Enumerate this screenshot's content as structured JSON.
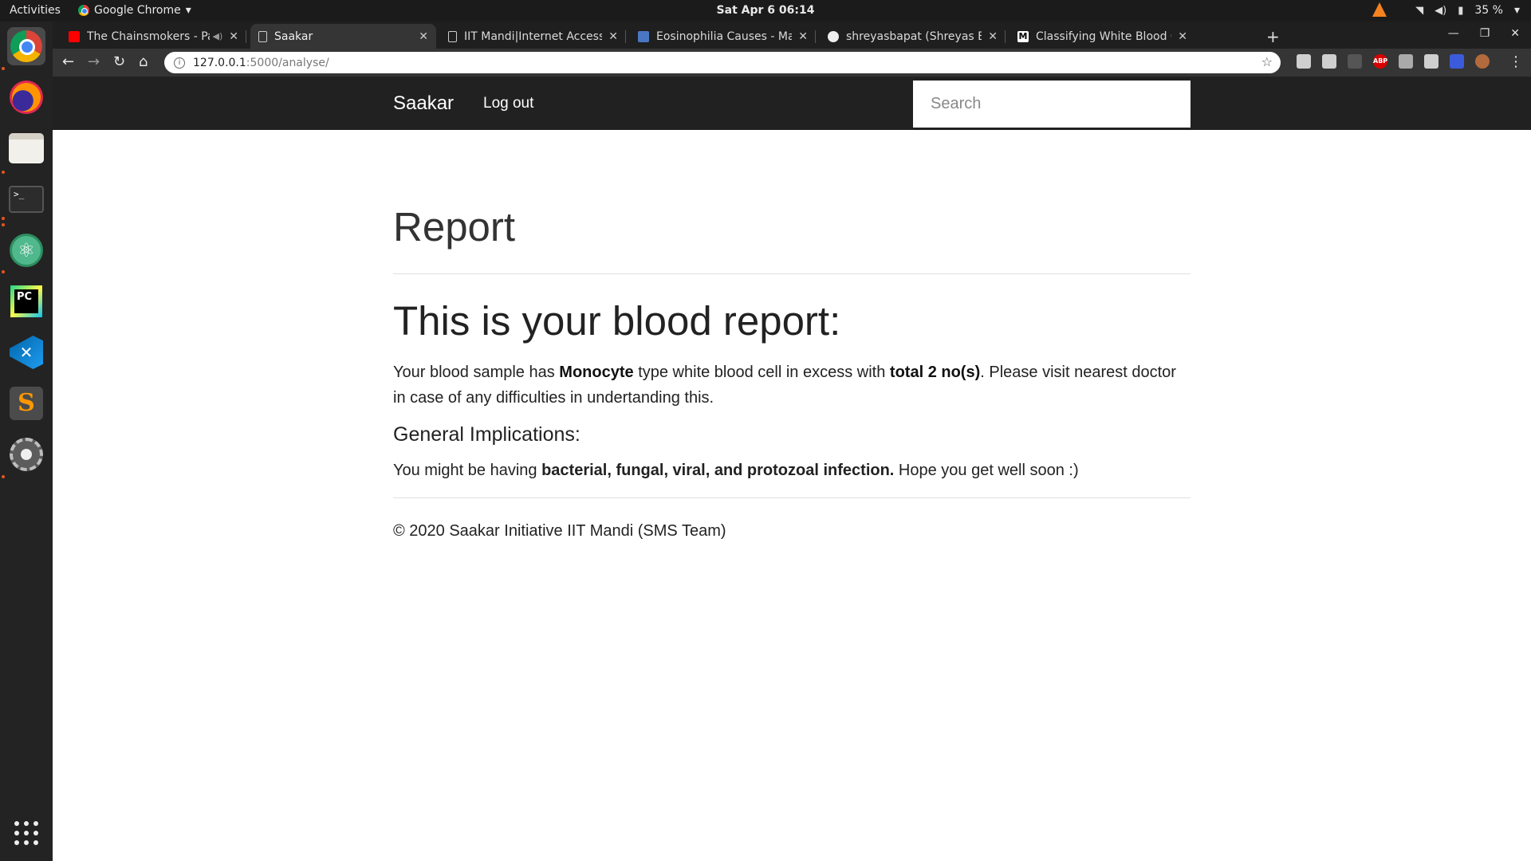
{
  "top_bar": {
    "activities": "Activities",
    "app_name": "Google Chrome",
    "clock": "Sat Apr 6  06:14",
    "battery": "35 %"
  },
  "dock": {
    "apps": [
      "Google Chrome",
      "Firefox",
      "Files",
      "Terminal",
      "Atom",
      "PyCharm",
      "Visual Studio Code",
      "Sublime Text",
      "Settings"
    ],
    "terminal_glyph": ">_",
    "pycharm_glyph": "PC",
    "sublime_glyph": "S"
  },
  "tabs": [
    {
      "title": "The Chainsmokers - Pa",
      "icon": "youtube-icon"
    },
    {
      "title": "Saakar",
      "icon": "document-icon"
    },
    {
      "title": "IIT Mandi|Internet Access",
      "icon": "document-icon"
    },
    {
      "title": "Eosinophilia Causes - May",
      "icon": "eosinophilia-favicon"
    },
    {
      "title": "shreyasbapat (Shreyas Ba",
      "icon": "github-icon"
    },
    {
      "title": "Classifying White Blood C",
      "icon": "medium-icon"
    }
  ],
  "address_bar": {
    "host": "127.0.0.1",
    "path": ":5000/analyse/"
  },
  "site": {
    "brand": "Saakar",
    "logout": "Log out",
    "search_placeholder": "Search"
  },
  "report": {
    "page_heading": "Report",
    "heading": "This is your blood report:",
    "text_intro": "Your blood sample has ",
    "cell_type": "Monocyte",
    "text_mid": " type white blood cell in excess with ",
    "count": "total 2 no(s)",
    "text_end": ". Please visit nearest doctor in case of any difficulties in undertanding this.",
    "implications_heading": "General Implications:",
    "implications_intro": "You might be having ",
    "implications_conditions": "bacterial, fungal, viral, and protozoal infection.",
    "implications_end": " Hope you get well soon :)"
  },
  "footer": {
    "text": "© 2020 Saakar Initiative IIT Mandi (SMS Team)"
  }
}
